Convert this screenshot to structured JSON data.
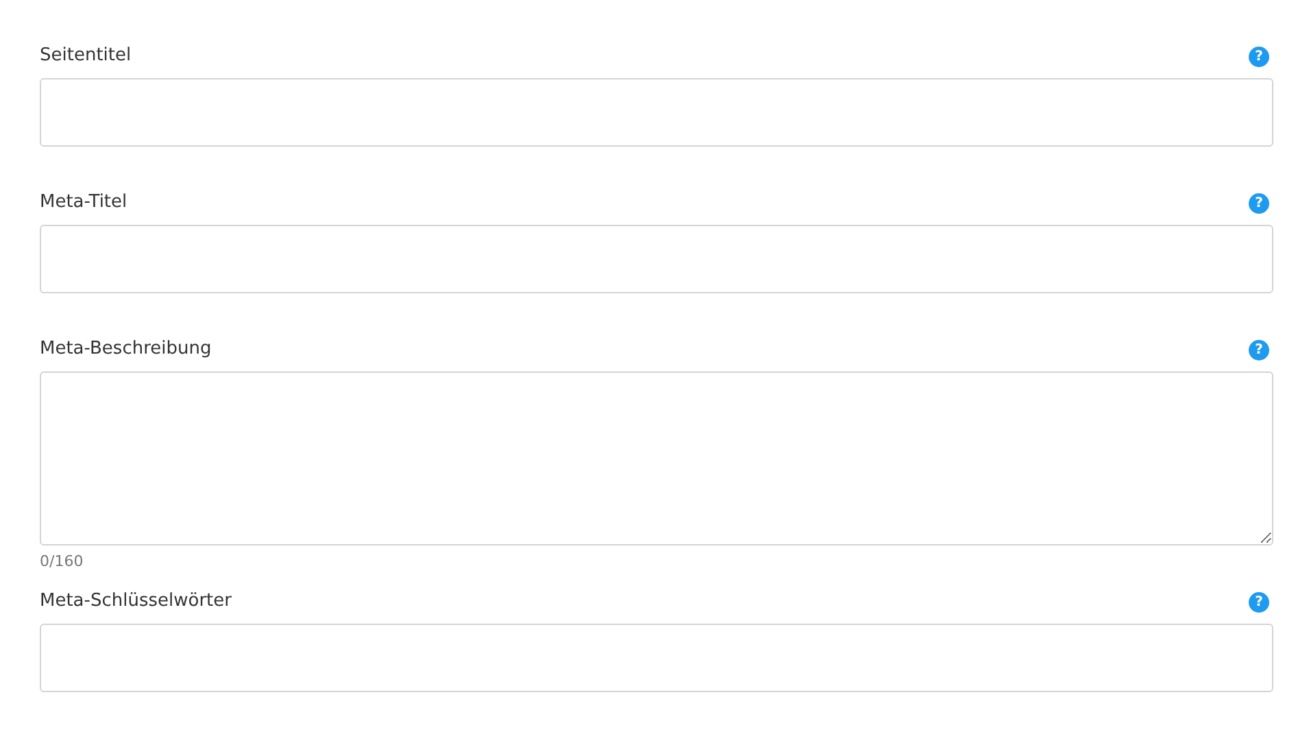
{
  "fields": [
    {
      "label": "Seitentitel",
      "kind": "input",
      "help": "?"
    },
    {
      "label": "Meta-Titel",
      "kind": "input",
      "help": "?"
    },
    {
      "label": "Meta-Beschreibung",
      "kind": "textarea",
      "help": "?",
      "counter": "0/160"
    },
    {
      "label": "Meta-Schlüsselwörter",
      "kind": "input",
      "help": "?"
    }
  ]
}
